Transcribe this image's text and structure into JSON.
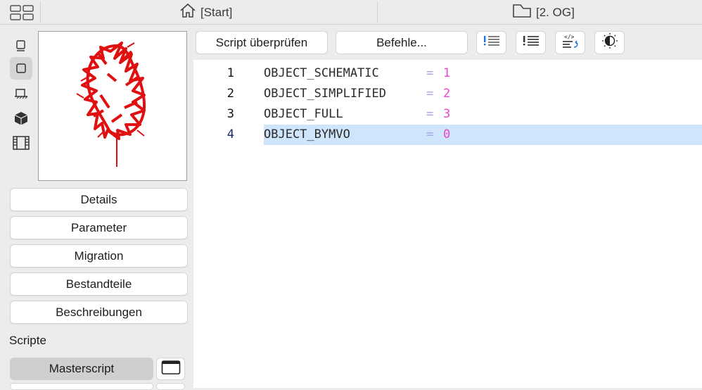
{
  "header": {
    "tabs": [
      {
        "label": "[Start]",
        "icon": "home-icon"
      },
      {
        "label": "[2. OG]",
        "icon": "floor-icon"
      }
    ]
  },
  "sidebar": {
    "view_icons": [
      "2d-view-icon",
      "plan-view-icon",
      "section-view-icon",
      "3d-view-icon",
      "film-icon"
    ],
    "buttons": [
      {
        "label": "Details"
      },
      {
        "label": "Parameter"
      },
      {
        "label": "Migration"
      },
      {
        "label": "Bestandteile"
      },
      {
        "label": "Beschreibungen"
      }
    ],
    "section_label": "Scripte",
    "master_label": "Masterscript"
  },
  "toolbar": {
    "check_label": "Script überprüfen",
    "commands_label": "Befehle..."
  },
  "code": {
    "lines": [
      {
        "no": "1",
        "name": "OBJECT_SCHEMATIC",
        "op": "=",
        "value": "1"
      },
      {
        "no": "2",
        "name": "OBJECT_SIMPLIFIED",
        "op": "=",
        "value": "2"
      },
      {
        "no": "3",
        "name": "OBJECT_FULL",
        "op": "=",
        "value": "3"
      },
      {
        "no": "4",
        "name": "OBJECT_BYMVO",
        "op": "=",
        "value": "0"
      }
    ],
    "current_line": 4
  },
  "colors": {
    "highlight": "#cfe5fb",
    "number": "#ee44cc",
    "operator": "#a8a0e8",
    "preview_stroke": "#e01010"
  }
}
